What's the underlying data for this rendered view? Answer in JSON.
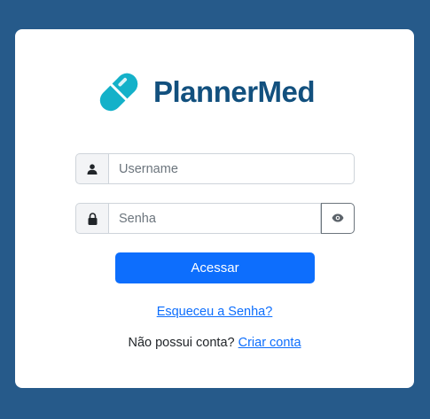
{
  "brand": {
    "name": "PlannerMed",
    "logo_icon": "pill-capsule-icon",
    "colors": {
      "text": "#12507e",
      "pill": "#14b1c9"
    }
  },
  "form": {
    "username": {
      "icon": "user-icon",
      "value": "",
      "placeholder": "Username"
    },
    "password": {
      "icon": "lock-icon",
      "value": "",
      "placeholder": "Senha",
      "toggle_icon": "eye-icon"
    },
    "submit_label": "Acessar"
  },
  "links": {
    "forgot_password": "Esqueceu a Senha?",
    "signup_prompt": "Não possui conta?",
    "signup_link": "Criar conta"
  },
  "colors": {
    "background": "#265a8a",
    "primary": "#0d6efd"
  }
}
